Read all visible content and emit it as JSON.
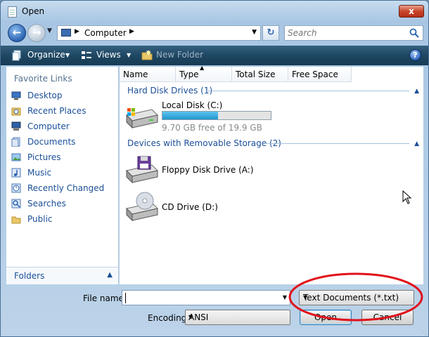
{
  "window": {
    "title": "Open",
    "close_label": "x"
  },
  "navigation": {
    "location": "Computer",
    "search_placeholder": "Search"
  },
  "toolbar": {
    "organize_label": "Organize",
    "views_label": "Views",
    "new_folder_label": "New Folder",
    "help_label": "?"
  },
  "sidebar": {
    "heading": "Favorite Links",
    "items": [
      {
        "label": "Desktop",
        "icon": "desktop-icon"
      },
      {
        "label": "Recent Places",
        "icon": "recent-places-icon"
      },
      {
        "label": "Computer",
        "icon": "computer-icon"
      },
      {
        "label": "Documents",
        "icon": "documents-icon"
      },
      {
        "label": "Pictures",
        "icon": "pictures-icon"
      },
      {
        "label": "Music",
        "icon": "music-icon"
      },
      {
        "label": "Recently Changed",
        "icon": "recently-changed-icon"
      },
      {
        "label": "Searches",
        "icon": "searches-icon"
      },
      {
        "label": "Public",
        "icon": "public-icon"
      }
    ],
    "folders_label": "Folders"
  },
  "columns": [
    "Name",
    "Type",
    "Total Size",
    "Free Space"
  ],
  "groups": {
    "hard_disks": {
      "label": "Hard Disk Drives (1)",
      "drive": {
        "name": "Local Disk (C:)",
        "free_text": "9.70 GB free of 19.9 GB",
        "used_fraction": 0.51
      }
    },
    "removable": {
      "label": "Devices with Removable Storage (2)",
      "floppy": "Floppy Disk Drive (A:)",
      "cd": "CD Drive (D:)"
    }
  },
  "bottom": {
    "file_name_label": "File name:",
    "file_name_value": "",
    "file_type": "Text Documents (*.txt)",
    "encoding_label": "Encoding:",
    "encoding_value": "ANSI",
    "open_label": "Open",
    "cancel_label": "Cancel"
  },
  "colors": {
    "annotation": "#e0121b",
    "link": "#1b4f99",
    "toolbar": "#1e4763"
  }
}
